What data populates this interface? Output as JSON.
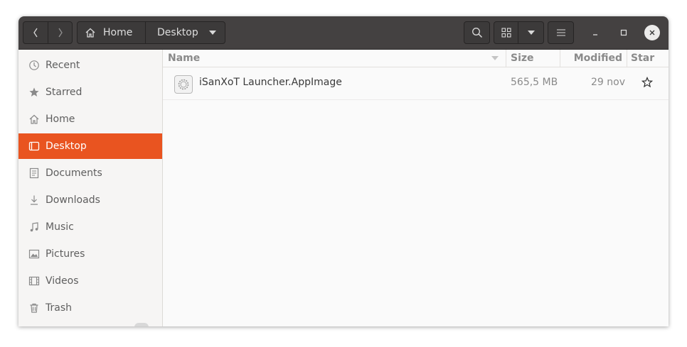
{
  "header": {
    "back_icon": "chevron-left-icon",
    "forward_icon": "chevron-right-icon",
    "path": [
      {
        "label": "Home",
        "icon": "home-icon"
      },
      {
        "label": "Desktop",
        "icon": "dropdown-arrow-icon"
      }
    ],
    "search_icon": "search-icon",
    "view_icon": "grid-view-icon",
    "view_menu_icon": "dropdown-arrow-icon",
    "menu_icon": "hamburger-menu-icon",
    "window_controls": [
      "minimize",
      "maximize",
      "close"
    ]
  },
  "sidebar": {
    "items": [
      {
        "label": "Recent",
        "icon": "clock-icon"
      },
      {
        "label": "Starred",
        "icon": "star-icon"
      },
      {
        "label": "Home",
        "icon": "home-icon"
      },
      {
        "label": "Desktop",
        "icon": "desktop-icon",
        "active": true
      },
      {
        "label": "Documents",
        "icon": "document-icon"
      },
      {
        "label": "Downloads",
        "icon": "download-icon"
      },
      {
        "label": "Music",
        "icon": "music-icon"
      },
      {
        "label": "Pictures",
        "icon": "picture-icon"
      },
      {
        "label": "Videos",
        "icon": "video-icon"
      },
      {
        "label": "Trash",
        "icon": "trash-icon"
      }
    ]
  },
  "file_list": {
    "columns": [
      "Name",
      "Size",
      "Modified",
      "Star"
    ],
    "rows": [
      {
        "name": "iSanXoT Launcher.AppImage",
        "size": "565,5 MB",
        "modified": "29 nov",
        "starred": false,
        "icon": "executable-file-icon"
      }
    ]
  },
  "colors": {
    "accent": "#e95420",
    "headerbar": "#444141",
    "sidebar_bg": "#f6f5f4",
    "content_bg": "#fafafa"
  }
}
